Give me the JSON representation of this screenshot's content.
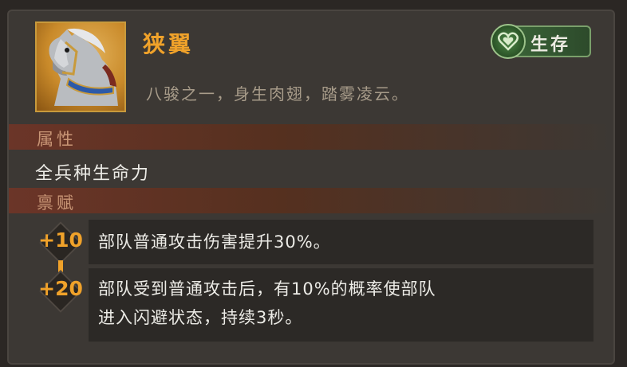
{
  "card": {
    "title": "狭翼",
    "badge": {
      "icon": "heart-shield-icon",
      "label": "生存"
    },
    "description": "八骏之一，身生肉翅，踏雾凌云。"
  },
  "attributes": {
    "header": "属性",
    "text": "全兵种生命力"
  },
  "talents": {
    "header": "禀赋",
    "items": [
      {
        "level": "+10",
        "text": "部队普通攻击伤害提升30%。"
      },
      {
        "level": "+20",
        "text_line1": "部队受到普通攻击后，有10%的概率使部队",
        "text_line2": "进入闪避状态，持续3秒。"
      }
    ]
  },
  "colors": {
    "accent": "#f0a22a",
    "badge_green": "#3d6a3a",
    "section_red": "#6b3528"
  }
}
